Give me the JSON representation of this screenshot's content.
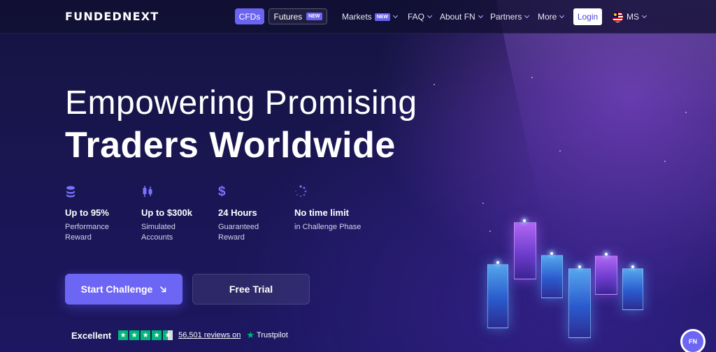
{
  "brand": {
    "logo": "FUNDEDNEXT"
  },
  "nav": {
    "cfds_label": "CFDs",
    "futures_label": "Futures",
    "futures_badge": "NEW",
    "markets_label": "Markets",
    "markets_badge": "NEW",
    "faq_label": "FAQ",
    "about_label": "About FN",
    "partners_label": "Partners",
    "more_label": "More",
    "login_label": "Login",
    "language": "MS"
  },
  "hero": {
    "line1": "Empowering Promising",
    "line2": "Traders Worldwide"
  },
  "features": [
    {
      "icon": "coins-stack-icon",
      "title": "Up to 95%",
      "line1": "Performance",
      "line2": "Reward"
    },
    {
      "icon": "candlestick-icon",
      "title": "Up to $300k",
      "line1": "Simulated",
      "line2": "Accounts"
    },
    {
      "icon": "dollar-icon",
      "title": "24 Hours",
      "line1": "Guaranteed",
      "line2": "Reward"
    },
    {
      "icon": "spinner-icon",
      "title": "No time limit",
      "line1": "in Challenge Phase",
      "line2": ""
    }
  ],
  "cta": {
    "start_label": "Start Challenge",
    "trial_label": "Free Trial"
  },
  "trustpilot": {
    "rating_text": "Excellent",
    "rating_stars": 4.5,
    "reviews_text": "56,501 reviews on",
    "brand": "Trustpilot"
  },
  "chat": {
    "label": "FN"
  },
  "colors": {
    "accent": "#6d66f4",
    "trustpilot_green": "#00b67a",
    "background": "#1a1654"
  }
}
